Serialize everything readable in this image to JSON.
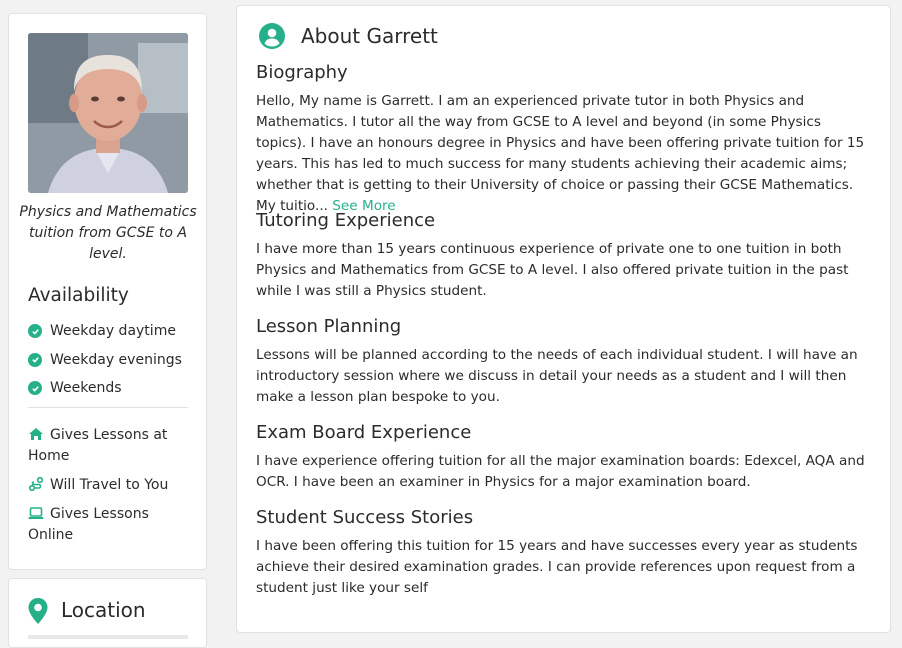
{
  "profile": {
    "tagline": "Physics and Mathematics tuition from GCSE to A level.",
    "availability_title": "Availability",
    "availability": [
      {
        "label": "Weekday daytime",
        "icon": "check-circle-icon"
      },
      {
        "label": "Weekday evenings",
        "icon": "check-circle-icon"
      },
      {
        "label": "Weekends",
        "icon": "check-circle-icon"
      }
    ],
    "options": [
      {
        "label": "Gives Lessons at Home",
        "icon": "home-icon"
      },
      {
        "label": "Will Travel to You",
        "icon": "route-icon"
      },
      {
        "label": "Gives Lessons Online",
        "icon": "laptop-icon"
      }
    ]
  },
  "location": {
    "title": "Location",
    "icon": "map-pin-icon"
  },
  "about": {
    "title": "About Garrett",
    "icon": "user-circle-icon",
    "sections": [
      {
        "heading": "Biography",
        "text": "Hello, My name is Garrett. I am an experienced private tutor in both Physics and Mathematics. I tutor all the way from GCSE to A level and beyond (in some Physics topics). I have an honours degree in Physics and have been offering private tuition for 15 years. This has led to much success for many students achieving their academic aims; whether that is getting to their University of choice or passing their GCSE Mathematics. My tuitio...",
        "link": "See More"
      },
      {
        "heading": "Tutoring Experience",
        "text": "I have more than 15 years continuous experience of private one to one tuition in both Physics and Mathematics from GCSE to A level. I also offered private tuition in the past while I was still a Physics student."
      },
      {
        "heading": "Lesson Planning",
        "text": "Lessons will be planned according to the needs of each individual student. I will have an introductory session where we discuss in detail your needs as a student and I will then make a lesson plan bespoke to you."
      },
      {
        "heading": "Exam Board Experience",
        "text": "I have experience offering tuition for all the major examination boards: Edexcel, AQA and OCR. I have been an examiner in Physics for a major examination board."
      },
      {
        "heading": "Student Success Stories",
        "text": "I have been offering this tuition for 15 years and have successes every year as students achieve their desired examination grades. I can provide references upon request from a student just like your self"
      }
    ]
  },
  "colors": {
    "accent": "#26b08a",
    "text": "#2b2b2b",
    "border": "#e1e1e1",
    "background": "#f2f2f2"
  }
}
